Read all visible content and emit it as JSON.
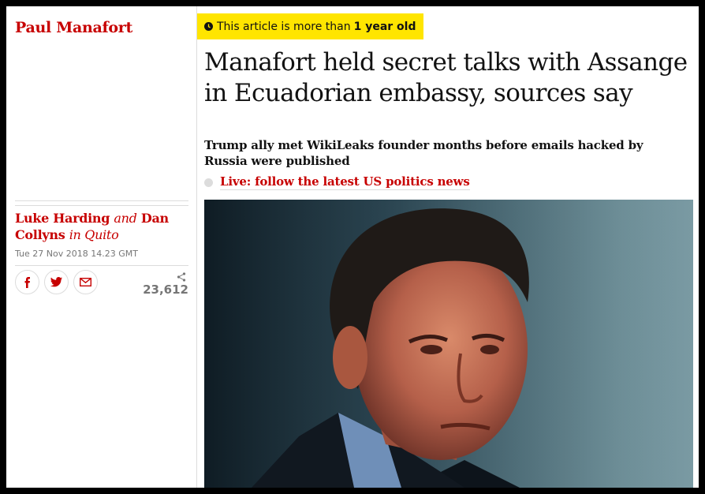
{
  "section": {
    "title": "Paul Manafort"
  },
  "byline": {
    "author1": "Luke Harding",
    "and": "and",
    "author2": "Dan Collyns",
    "location": "in Quito"
  },
  "dateline": "Tue 27 Nov 2018 14.23 GMT",
  "share": {
    "facebook_icon": "facebook-icon",
    "twitter_icon": "twitter-icon",
    "email_icon": "email-icon",
    "count": "23,612"
  },
  "article": {
    "age_notice_prefix": "This article is more than",
    "age_notice_bold": "1 year old",
    "headline": "Manafort held secret talks with Assange in Ecuadorian embassy, sources say",
    "standfirst": "Trump ally met WikiLeaks founder months before emails hacked by Russia were published",
    "live_link": "Live: follow the latest US politics news"
  },
  "colors": {
    "accent": "#c70000",
    "badge": "#ffe500",
    "text": "#121212",
    "muted": "#767676"
  }
}
